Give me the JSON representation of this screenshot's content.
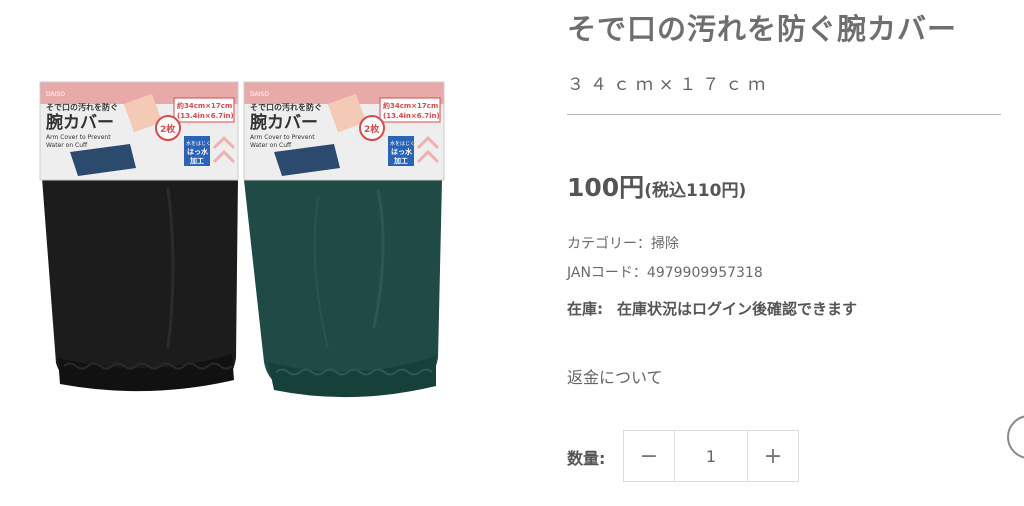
{
  "product": {
    "title": "そで口の汚れを防ぐ腕カバー",
    "size": "３４ｃｍ×１７ｃｍ",
    "price_main": "100円",
    "price_tax": "(税込110円)",
    "category": "カテゴリー：掃除",
    "jan": "JANコード：4979909957318",
    "stock_label": "在庫:",
    "stock_value": "在庫状況はログイン後確認できます",
    "refund_link": "返金について",
    "quantity_label": "数量:",
    "quantity_value": "1",
    "minus": "−",
    "plus": "+"
  },
  "package": {
    "brand": "DAISO",
    "tagline": "そで口の汚れを防ぐ",
    "name": "腕カバー",
    "en_line1": "Arm Cover to Prevent",
    "en_line2": "Water on Cuff",
    "size_line1": "約34cm×17cm",
    "size_line2": "(13.4in×6.7in)",
    "pair_count": "2枚",
    "feature_line1": "水をはじく",
    "feature_line2": "はっ水",
    "feature_line3": "加工"
  },
  "colors": {
    "black_variant": "#1c1c1c",
    "green_variant": "#1f4a45",
    "header_pink": "#e8a9a9",
    "accent_red": "#d94a4a",
    "badge_blue": "#2a63b8"
  }
}
